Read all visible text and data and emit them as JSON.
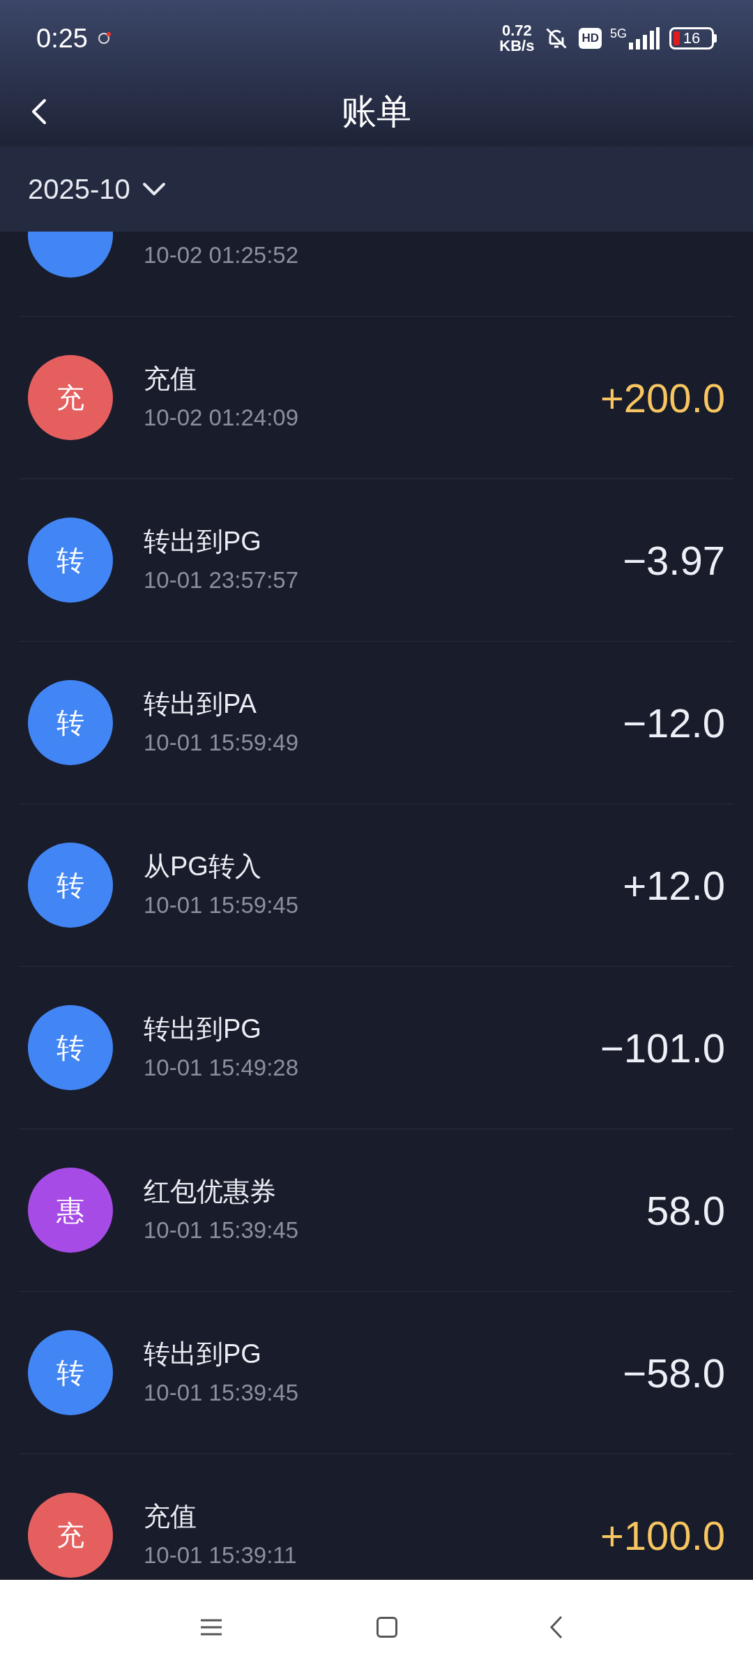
{
  "status_bar": {
    "time": "0:25",
    "speed_value": "0.72",
    "speed_unit": "KB/s",
    "hd": "HD",
    "network": "5G",
    "battery": "16"
  },
  "header": {
    "title": "账单"
  },
  "month_filter": {
    "label": "2025-10"
  },
  "transactions": [
    {
      "color": "#4285f4",
      "time": "10-02 01:25:52"
    },
    {
      "badge": "充",
      "color": "#e55f5f",
      "title": "充值",
      "time": "10-02 01:24:09",
      "amount": "+200.0",
      "highlight": true
    },
    {
      "badge": "转",
      "color": "#4285f4",
      "title": "转出到PG",
      "time": "10-01 23:57:57",
      "amount": "−3.97",
      "highlight": false
    },
    {
      "badge": "转",
      "color": "#4285f4",
      "title": "转出到PA",
      "time": "10-01 15:59:49",
      "amount": "−12.0",
      "highlight": false
    },
    {
      "badge": "转",
      "color": "#4285f4",
      "title": "从PG转入",
      "time": "10-01 15:59:45",
      "amount": "+12.0",
      "highlight": false
    },
    {
      "badge": "转",
      "color": "#4285f4",
      "title": "转出到PG",
      "time": "10-01 15:49:28",
      "amount": "−101.0",
      "highlight": false
    },
    {
      "badge": "惠",
      "color": "#a64be6",
      "title": "红包优惠券",
      "time": "10-01 15:39:45",
      "amount": "58.0",
      "highlight": false
    },
    {
      "badge": "转",
      "color": "#4285f4",
      "title": "转出到PG",
      "time": "10-01 15:39:45",
      "amount": "−58.0",
      "highlight": false
    },
    {
      "badge": "充",
      "color": "#e55f5f",
      "title": "充值",
      "time": "10-01 15:39:11",
      "amount": "+100.0",
      "highlight": true
    }
  ]
}
